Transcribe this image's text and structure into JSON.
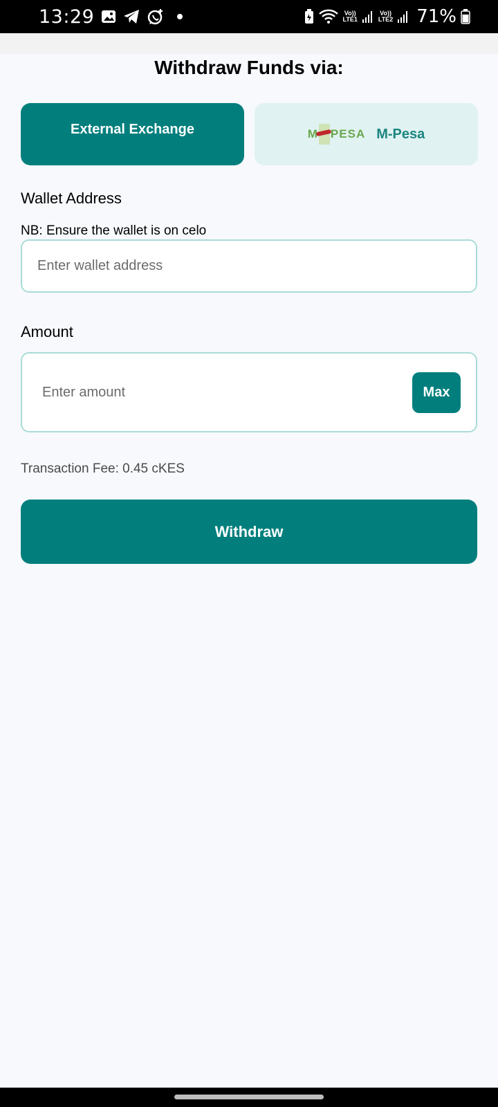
{
  "status_bar": {
    "time": "13:29",
    "left_icons": [
      "image-icon",
      "telegram-icon",
      "whatsapp-icon",
      "notification-dot-icon"
    ],
    "sim1_label_top": "Vo))",
    "sim1_label_bottom": "LTE1",
    "sim2_label_top": "Vo))",
    "sim2_label_bottom": "LTE2",
    "battery_percent": "71%"
  },
  "page": {
    "title": "Withdraw Funds via:"
  },
  "methods": {
    "external_label": "External Exchange",
    "mpesa_label": "M-Pesa",
    "mpesa_logo_left": "M",
    "mpesa_logo_right": "PESA"
  },
  "wallet": {
    "label": "Wallet Address",
    "note": "NB: Ensure the wallet is on celo",
    "placeholder": "Enter wallet address",
    "value": ""
  },
  "amount": {
    "label": "Amount",
    "placeholder": "Enter amount",
    "value": "",
    "max_label": "Max"
  },
  "fee": {
    "text": "Transaction Fee: 0.45 cKES"
  },
  "actions": {
    "withdraw_label": "Withdraw"
  },
  "colors": {
    "primary": "#027f7d",
    "secondary_bg": "#e0f2f1",
    "input_border": "#a9dcd7",
    "page_bg": "#f7f9fd"
  }
}
